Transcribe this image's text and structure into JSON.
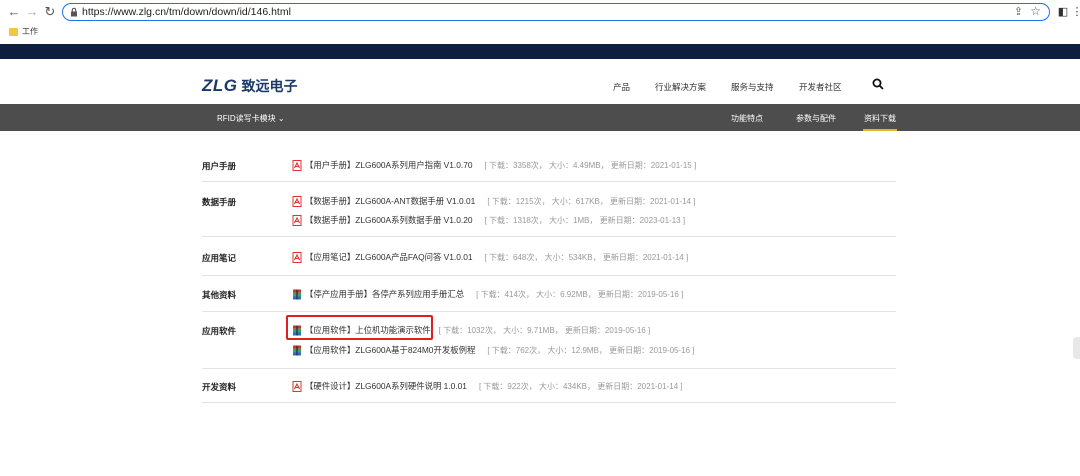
{
  "browser": {
    "url": "https://www.zlg.cn/tm/down/down/id/146.html",
    "bookmark": "工作"
  },
  "site": {
    "logo_text": "ZLG",
    "logo_cn": "致远电子",
    "nav": [
      "产品",
      "行业解决方案",
      "服务与支持",
      "开发者社区"
    ],
    "subnav_left": "RFID读写卡模块 ⌄",
    "subnav_right": [
      "功能特点",
      "参数与配件",
      "资料下载"
    ],
    "active_color": "#e4b41c"
  },
  "sections": [
    {
      "category": "用户手册",
      "entries": [
        {
          "icon": "pdf-icon",
          "title": "【用户手册】ZLG600A系列用户指南 V1.0.70",
          "meta": "[ 下载：3358次， 大小：4.49MB， 更新日期：2021-01-15 ]"
        }
      ]
    },
    {
      "category": "数据手册",
      "entries": [
        {
          "icon": "pdf-icon",
          "title": "【数据手册】ZLG600A-ANT数据手册 V1.0.01",
          "meta": "[ 下载：1215次， 大小：617KB， 更新日期：2021-01-14 ]"
        },
        {
          "icon": "pdf-icon",
          "title": "【数据手册】ZLG600A系列数据手册 V1.0.20",
          "meta": "[ 下载：1318次， 大小：1MB， 更新日期：2023-01-13 ]"
        }
      ]
    },
    {
      "category": "应用笔记",
      "entries": [
        {
          "icon": "pdf-icon",
          "title": "【应用笔记】ZLG600A产品FAQ问答 V1.0.01",
          "meta": "[ 下载：648次， 大小：534KB， 更新日期：2021-01-14 ]"
        }
      ]
    },
    {
      "category": "其他资料",
      "entries": [
        {
          "icon": "archive-icon",
          "title": "【停产应用手册】各停产系列应用手册汇总",
          "meta": "[ 下载：414次， 大小：6.92MB， 更新日期：2019-05-16 ]"
        }
      ]
    },
    {
      "category": "应用软件",
      "entries": [
        {
          "icon": "archive-icon",
          "title": "【应用软件】上位机功能演示软件",
          "meta": "[ 下载：1032次， 大小：9.71MB， 更新日期：2019-05-16 ]"
        },
        {
          "icon": "archive-icon",
          "title": "【应用软件】ZLG600A基于824M0开发板例程",
          "meta": "[ 下载：762次， 大小：12.9MB， 更新日期：2019-05-16 ]"
        }
      ]
    },
    {
      "category": "开发资料",
      "entries": [
        {
          "icon": "pdf-icon",
          "title": "【硬件设计】ZLG600A系列硬件说明 1.0.01",
          "meta": "[ 下载：922次， 大小：434KB， 更新日期：2021-01-14 ]"
        }
      ]
    }
  ]
}
